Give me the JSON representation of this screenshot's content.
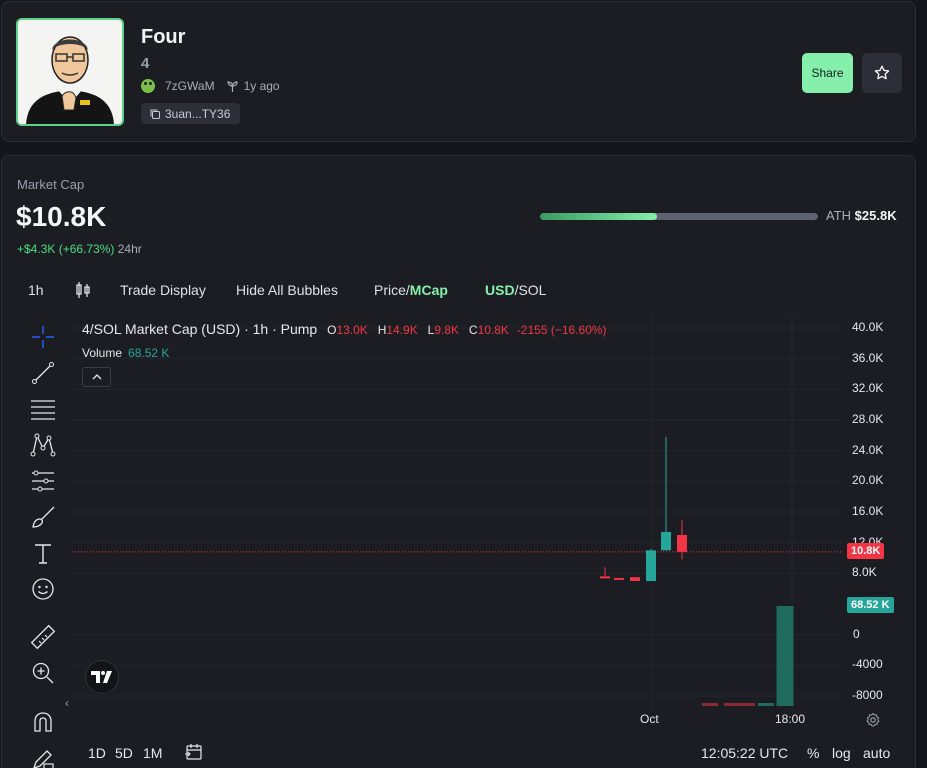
{
  "token": {
    "name": "Four",
    "symbol": "4",
    "creator": "7zGWaM",
    "age": "1y ago",
    "contract_short": "3uan...TY36"
  },
  "actions": {
    "share_label": "Share"
  },
  "market": {
    "label": "Market Cap",
    "value": "$10.8K",
    "change": "+$4.3K (+66.73%)",
    "period": "24hr",
    "ath_label": "ATH",
    "ath_value": "$25.8K",
    "ath_progress": 0.42
  },
  "toolbar": {
    "interval": "1h",
    "trade_display": "Trade Display",
    "hide_bubbles": "Hide All Bubbles",
    "price_label": "Price",
    "slash": "/",
    "mcap_label": "MCap",
    "usd_label": "USD",
    "sol_label": "SOL"
  },
  "legend": {
    "title": "4/SOL Market Cap (USD) · 1h · Pump",
    "o_key": "O",
    "o_val": "13.0K",
    "h_key": "H",
    "h_val": "14.9K",
    "l_key": "L",
    "l_val": "9.8K",
    "c_key": "C",
    "c_val": "10.8K",
    "change": "-2155 (−16.60%)",
    "volume_label": "Volume",
    "volume_value": "68.52 K"
  },
  "axis": {
    "y_ticks": [
      "40.0K",
      "36.0K",
      "32.0K",
      "28.0K",
      "24.0K",
      "20.0K",
      "16.0K",
      "12.0K",
      "8.0K",
      "0",
      "-4000",
      "-8000"
    ],
    "x_ticks": [
      "Oct",
      "18:00"
    ],
    "last_price_tag": "10.8K",
    "volume_tag": "68.52 K"
  },
  "bottom": {
    "range_1d": "1D",
    "range_5d": "5D",
    "range_1m": "1M",
    "time": "12:05:22 UTC",
    "percent": "%",
    "log": "log",
    "auto": "auto"
  },
  "colors": {
    "up": "#26a69a",
    "down": "#f23645",
    "accent": "#86efac"
  },
  "chart_data": {
    "type": "candlestick",
    "title": "4/SOL Market Cap (USD) · 1h · Pump",
    "candles": [
      {
        "o": 7600,
        "h": 8800,
        "l": 7500,
        "c": 7500,
        "dir": "down"
      },
      {
        "o": 7400,
        "h": 7400,
        "l": 7300,
        "c": 7300,
        "dir": "down"
      },
      {
        "o": 7500,
        "h": 7500,
        "l": 7000,
        "c": 7000,
        "dir": "down"
      },
      {
        "o": 7000,
        "h": 11200,
        "l": 7000,
        "c": 11000,
        "dir": "up"
      },
      {
        "o": 11000,
        "h": 25800,
        "l": 11000,
        "c": 13400,
        "dir": "up"
      },
      {
        "o": 13000,
        "h": 14900,
        "l": 9800,
        "c": 10800,
        "dir": "down"
      }
    ],
    "volume": [
      {
        "v": 1800,
        "dir": "down"
      },
      {
        "v": 800,
        "dir": "down"
      },
      {
        "v": 600,
        "dir": "down"
      },
      {
        "v": 1600,
        "dir": "up"
      },
      {
        "v": 68520,
        "dir": "up"
      }
    ],
    "price_axis": {
      "min": -8000,
      "max": 40000
    },
    "x_labels": [
      "Oct",
      "18:00"
    ],
    "last_value": "10.8K"
  }
}
